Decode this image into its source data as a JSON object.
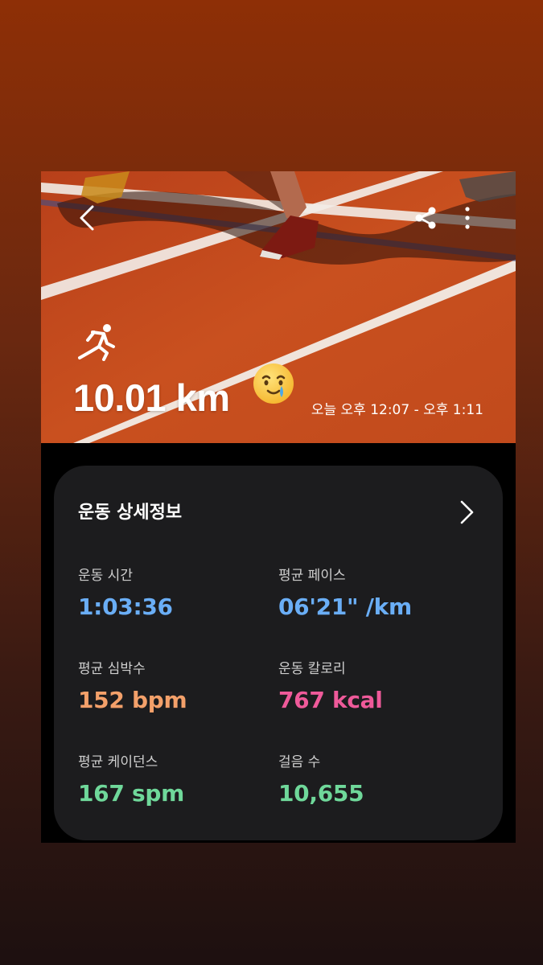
{
  "hero": {
    "distance": "10.01 km",
    "time_range": "오늘 오후 12:07 - 오후 1:11",
    "activity_icon": "running-icon",
    "emoji": "smiling-face-with-tear"
  },
  "toolbar": {
    "back_icon": "back-arrow-icon",
    "share_icon": "share-icon",
    "more_icon": "more-vertical-icon"
  },
  "details": {
    "title": "운동 상세정보",
    "metrics": [
      {
        "label": "운동 시간",
        "value": "1:03:36",
        "color": "#6aaef6"
      },
      {
        "label": "평균 페이스",
        "value": "06'21\" /km",
        "color": "#6aaef6"
      },
      {
        "label": "평균 심박수",
        "value": "152 bpm",
        "color": "#f3a06a"
      },
      {
        "label": "운동 칼로리",
        "value": "767 kcal",
        "color": "#ef5a9a"
      },
      {
        "label": "평균 케이던스",
        "value": "167 spm",
        "color": "#6fd89a"
      },
      {
        "label": "걸음 수",
        "value": "10,655",
        "color": "#6fd89a"
      }
    ]
  }
}
